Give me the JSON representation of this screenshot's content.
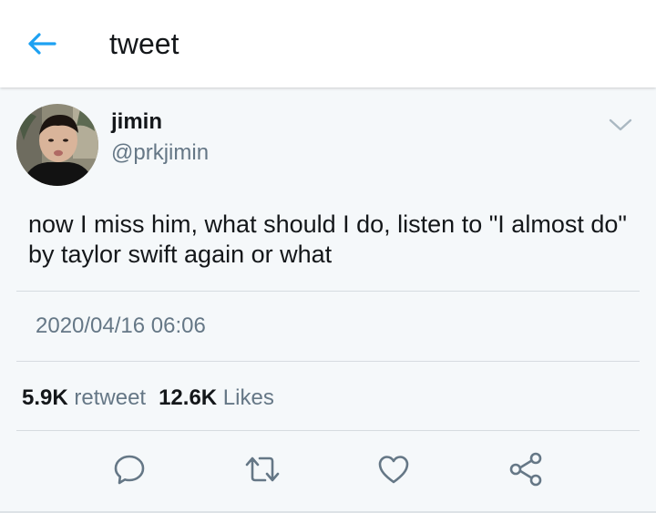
{
  "header": {
    "title": "tweet",
    "back_icon": "arrow-left-icon",
    "accent_color": "#1da1f2"
  },
  "tweet": {
    "display_name": "jimin",
    "handle": "@prkjimin",
    "text": "now I miss him, what should I do, listen to \"I almost do\" by taylor swift again or what",
    "timestamp": "2020/04/16 06:06",
    "retweet_count": "5.9K",
    "retweet_label": "retweet",
    "like_count": "12.6K",
    "like_label": "Likes"
  },
  "actions": [
    {
      "icon": "reply-icon"
    },
    {
      "icon": "retweet-icon"
    },
    {
      "icon": "heart-icon"
    },
    {
      "icon": "share-icon"
    }
  ],
  "colors": {
    "text_primary": "#14171a",
    "text_secondary": "#657786",
    "background": "#f5f8fa",
    "icon_gray": "#657786"
  }
}
